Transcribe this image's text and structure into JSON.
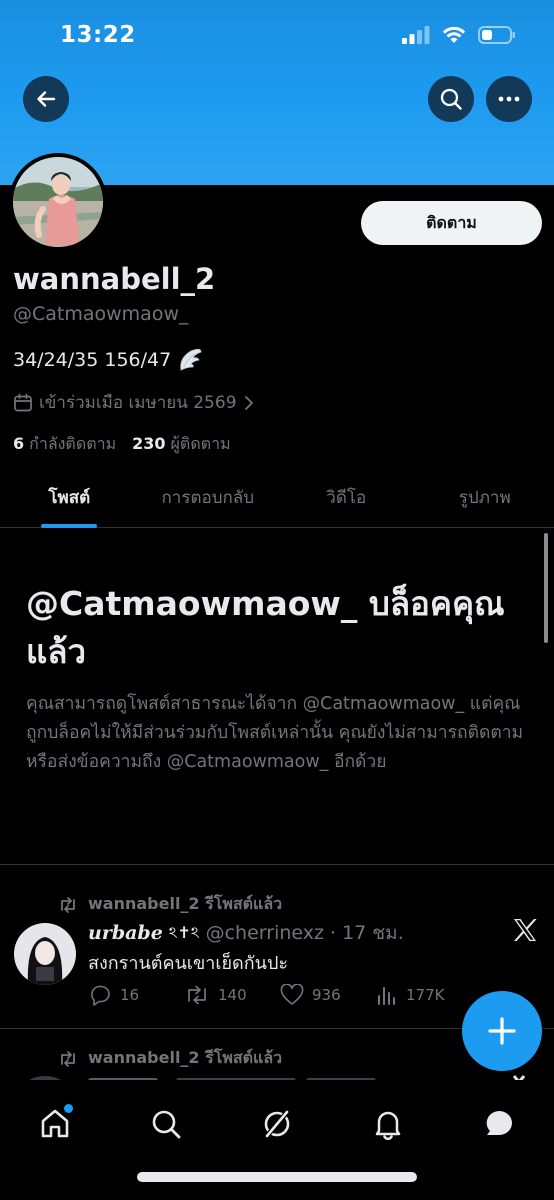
{
  "status_bar": {
    "time": "13:22"
  },
  "header": {
    "banner_color": "#1d9bf0"
  },
  "profile": {
    "follow_label": "ติดตาม",
    "display_name": "wannabell_2",
    "handle": "@Catmaowmaow_",
    "bio": "34/24/35 156/47",
    "joined": "เข้าร่วมเมือ เมษายน 2569",
    "following_count": "6",
    "following_label": "กำลังติดตาม",
    "followers_count": "230",
    "followers_label": "ผู้ติดตาม"
  },
  "tabs": [
    {
      "label": "โพสต์",
      "active": true
    },
    {
      "label": "การตอบกลับ",
      "active": false
    },
    {
      "label": "วิดีโอ",
      "active": false
    },
    {
      "label": "รูปภาพ",
      "active": false
    }
  ],
  "blocked": {
    "title": "@Catmaowmaow_ บล็อคคุณแล้ว",
    "description": "คุณสามารถดูโพสต์สาธารณะได้จาก @Catmaowmaow_ แต่คุณถูกบล็อคไม่ให้มีส่วนร่วมกับโพสต์เหล่านั้น คุณยังไม่สามารถติดตามหรือส่งข้อความถึง @Catmaowmaow_ อีกด้วย"
  },
  "post": {
    "retweet_label": "wannabell_2 รีโพสต์แล้ว",
    "author": "urbabe",
    "author_suffix": "ঽ✝︎ঽ",
    "author_handle": "@cherrinexz",
    "time": "· 17 ชม.",
    "text": "สงกรานต์คนเขาเย็ดกันปะ",
    "replies": "16",
    "reposts": "140",
    "likes": "936",
    "views": "177K"
  },
  "post2": {
    "retweet_label": "wannabell_2 รีโพสต์แล้ว"
  },
  "colors": {
    "accent": "#1d9bf0",
    "background": "#000000",
    "muted": "#71767b"
  }
}
